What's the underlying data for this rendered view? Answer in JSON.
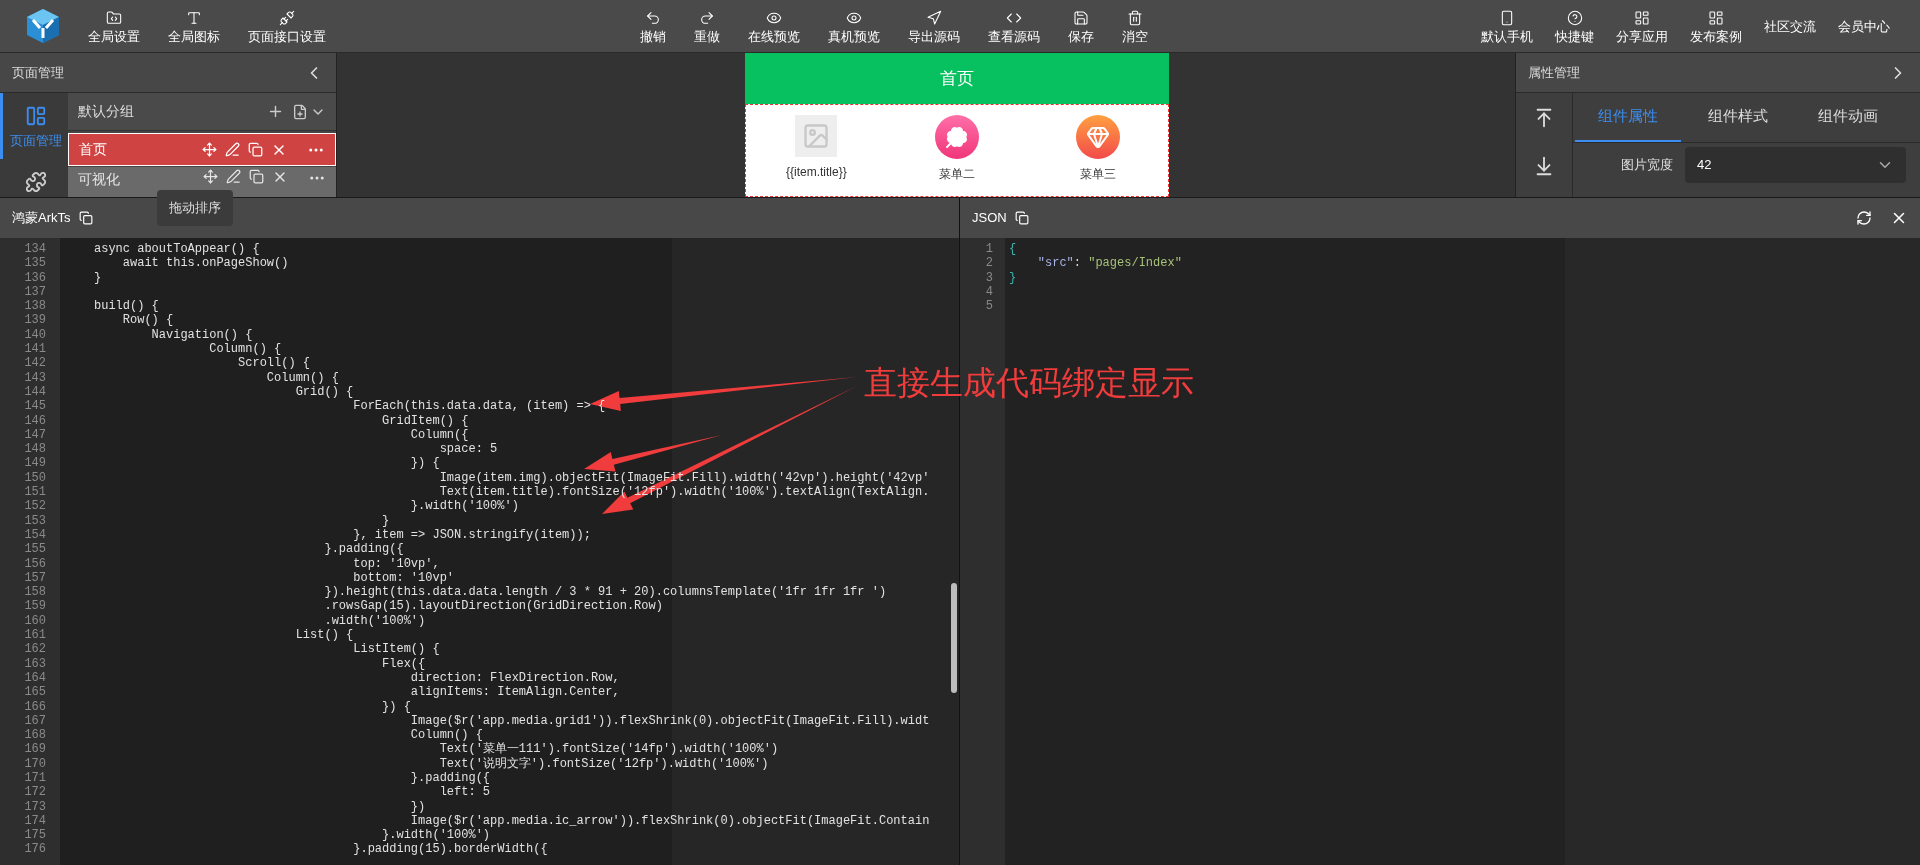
{
  "toolbar": {
    "left": [
      "全局设置",
      "全局图标",
      "页面接口设置"
    ],
    "center": [
      "撤销",
      "重做",
      "在线预览",
      "真机预览",
      "导出源码",
      "查看源码",
      "保存",
      "消空"
    ],
    "right": [
      "默认手机",
      "快捷键",
      "分享应用",
      "发布案例",
      "社区交流",
      "会员中心"
    ]
  },
  "page_panel": {
    "title": "页面管理",
    "rail": [
      {
        "kind": "pages",
        "label": "页面管理",
        "selected": true
      },
      {
        "kind": "components",
        "selected": false
      }
    ],
    "group": "默认分组",
    "pages": [
      {
        "name": "首页",
        "selected": true
      },
      {
        "name": "可视化",
        "selected": false
      }
    ],
    "tooltip": "拖动排序"
  },
  "preview": {
    "title": "首页",
    "items": [
      {
        "kind": "placeholder",
        "label": "{{item.title}}"
      },
      {
        "kind": "clover",
        "label": "菜单二"
      },
      {
        "kind": "gem",
        "label": "菜单三"
      }
    ]
  },
  "props_panel": {
    "title": "属性管理",
    "tabs": [
      {
        "label": "组件属性",
        "selected": true
      },
      {
        "label": "组件样式",
        "selected": false
      },
      {
        "label": "组件动画",
        "selected": false
      }
    ],
    "fields": [
      {
        "label": "图片宽度",
        "value": "42"
      }
    ]
  },
  "code_panel": {
    "title": "鸿蒙ArkTs",
    "lines": [
      {
        "number": "134",
        "code": "async aboutToAppear() {"
      },
      {
        "number": "135",
        "code": "    await this.onPageShow()"
      },
      {
        "number": "136",
        "code": "}"
      },
      {
        "number": "137"
      },
      {
        "number": "138",
        "code": "build() {"
      },
      {
        "number": "139",
        "code": "    Row() {"
      },
      {
        "number": "140",
        "code": "        Navigation() {"
      },
      {
        "number": "141",
        "code": "                Column() {"
      },
      {
        "number": "142",
        "code": "                    Scroll() {"
      },
      {
        "number": "143",
        "code": "                        Column() {"
      },
      {
        "number": "144",
        "code": "                            Grid() {"
      },
      {
        "number": "145",
        "code": "                                    ForEach(this.data.data, (item) => {"
      },
      {
        "number": "146",
        "code": "                                        GridItem() {"
      },
      {
        "number": "147",
        "code": "                                            Column({"
      },
      {
        "number": "148",
        "code": "                                                space: 5"
      },
      {
        "number": "149",
        "code": "                                            }) {"
      },
      {
        "number": "150",
        "code": "                                                Image(item.img).objectFit(ImageFit.Fill).width('42vp').height('42vp'"
      },
      {
        "number": "151",
        "code": "                                                Text(item.title).fontSize('12fp').width('100%').textAlign(TextAlign."
      },
      {
        "number": "152",
        "code": "                                            }.width('100%')"
      },
      {
        "number": "153",
        "code": "                                        }"
      },
      {
        "number": "154",
        "code": "                                    }, item => JSON.stringify(item));"
      },
      {
        "number": "155",
        "code": "                                }.padding({"
      },
      {
        "number": "156",
        "code": "                                    top: '10vp',"
      },
      {
        "number": "157",
        "code": "                                    bottom: '10vp'"
      },
      {
        "number": "158",
        "code": "                                }).height(this.data.data.length / 3 * 91 + 20).columnsTemplate('1fr 1fr 1fr ')"
      },
      {
        "number": "159",
        "code": "                                .rowsGap(15).layoutDirection(GridDirection.Row)"
      },
      {
        "number": "160",
        "code": "                                .width('100%')"
      },
      {
        "number": "161",
        "code": "                            List() {"
      },
      {
        "number": "162",
        "code": "                                    ListItem() {"
      },
      {
        "number": "163",
        "code": "                                        Flex({"
      },
      {
        "number": "164",
        "code": "                                            direction: FlexDirection.Row,"
      },
      {
        "number": "165",
        "code": "                                            alignItems: ItemAlign.Center,"
      },
      {
        "number": "166",
        "code": "                                        }) {"
      },
      {
        "number": "167",
        "code": "                                            Image($r('app.media.grid1')).flexShrink(0).objectFit(ImageFit.Fill).widt"
      },
      {
        "number": "168",
        "code": "                                            Column() {"
      },
      {
        "number": "169",
        "code": "                                                Text('菜单一111').fontSize('14fp').width('100%')"
      },
      {
        "number": "170",
        "code": "                                                Text('说明文字').fontSize('12fp').width('100%')"
      },
      {
        "number": "171",
        "code": "                                            }.padding({"
      },
      {
        "number": "172",
        "code": "                                                left: 5"
      },
      {
        "number": "173",
        "code": "                                            })"
      },
      {
        "number": "174",
        "code": "                                            Image($r('app.media.ic_arrow')).flexShrink(0).objectFit(ImageFit.Contain"
      },
      {
        "number": "175",
        "code": "                                        }.width('100%')"
      },
      {
        "number": "176",
        "code": "                                    }.padding(15).borderWidth({"
      }
    ]
  },
  "json_panel": {
    "title": "JSON",
    "lines": [
      {
        "number": "1",
        "tokens": [
          {
            "kind": "bracket",
            "text": "{"
          }
        ]
      },
      {
        "number": "2",
        "tokens": [
          {
            "kind": "key",
            "text": "    \"src\""
          },
          {
            "kind": "plain",
            "text": ": "
          },
          {
            "kind": "string",
            "text": "\"pages/Index\""
          }
        ]
      },
      {
        "number": "3",
        "tokens": [
          {
            "kind": "bracket",
            "text": "}"
          }
        ]
      },
      {
        "number": "4"
      },
      {
        "number": "5"
      }
    ]
  },
  "annotation": {
    "text": "直接生成代码绑定显示"
  }
}
